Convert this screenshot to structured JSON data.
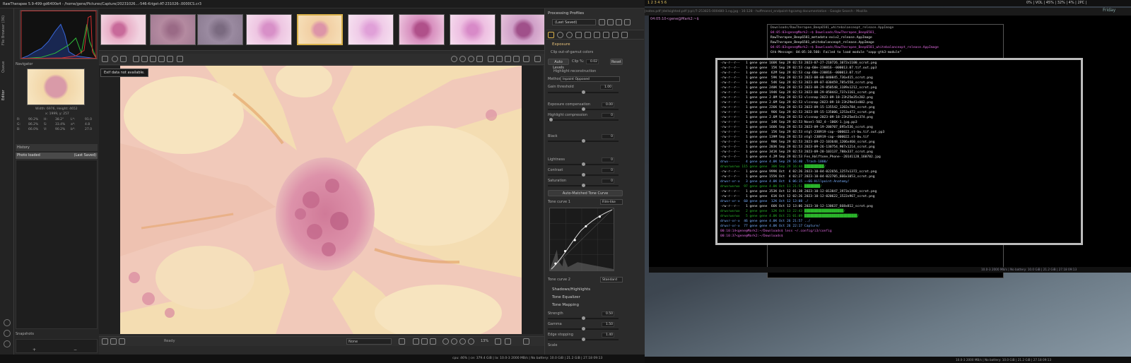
{
  "window_title": "RawTherapee 5.9-499-gd6400e4 - /home/gene/Pictures/Capture/20231026...-546-Kriget-AT-231026-.0000CS.cr3",
  "left_tabs": [
    "File Browser (36)",
    "Queue",
    "Editor"
  ],
  "navigator": {
    "label": "Navigator",
    "dims": "Width: 6976, Height: 4652",
    "coords": "x: 1999, y: 257",
    "rgb": [
      "R:",
      "90.2%",
      "G:",
      "86.2%",
      "B:",
      "66.0%"
    ],
    "hsv": [
      "H:",
      "38.2°",
      "S:",
      "33.4%",
      "V:",
      "90.2%"
    ],
    "lab": [
      "L*:",
      "91.0",
      "a*:",
      "4.8",
      "b*:",
      "27.0"
    ]
  },
  "history": {
    "label": "History",
    "row_left": "Photo loaded",
    "row_right": "(Last Saved)"
  },
  "snapshots": {
    "label": "Snapshots",
    "add": "+",
    "remove": "−"
  },
  "preview": {
    "exif_badge": "Exif data not available.",
    "status": "Ready",
    "zoom": "13%",
    "select": "None"
  },
  "right_panel": {
    "header": "Processing Profiles",
    "profile": "(Last Saved)",
    "section": "Exposure",
    "clip": "Clip out-of-gamut colors",
    "auto_levels": "Auto Levels",
    "clip_label": "Clip %:",
    "clip_val": "0.02",
    "reset": "Reset",
    "hr": "Highlight reconstruction",
    "method_label": "Method:",
    "method": "Inpaint Opposed",
    "gain_label": "Gain threshold",
    "gain_val": "1.00",
    "sliders": [
      {
        "label": "Exposure compensation",
        "val": "0.00"
      },
      {
        "label": "Highlight compression",
        "val": "0"
      },
      {
        "label": "Black",
        "val": "0"
      },
      {
        "label": "Lightness",
        "val": "0"
      },
      {
        "label": "Contrast",
        "val": "0"
      },
      {
        "label": "Saturation",
        "val": "0"
      }
    ],
    "auto_tc": "Auto-Matched Tone Curve",
    "tc1": "Tone curve 1",
    "tc1_mode": "Film-like",
    "tc2": "Tone curve 2",
    "tc2_mode": "Standard",
    "sections": [
      "Shadows/Highlights",
      "Tone Equalizer",
      "Tone Mapping"
    ],
    "tm_sliders": [
      {
        "label": "Strength",
        "val": "0.50"
      },
      {
        "label": "Gamma",
        "val": "1.50"
      },
      {
        "label": "Edge stopping",
        "val": "1.40"
      },
      {
        "label": "Scale",
        "val": ""
      }
    ]
  },
  "rt_status": "cpu: 46% | ce: 379.4 GiB | la: 10.0-3 2000 MB/s | No battery: 10.0 GiB | 21.2 GiB | 27.18 09:13",
  "desktop": {
    "ws": "1 2 3 4 5 6",
    "tabs": "|notes.pdf            |dellsighted.pdf           |cpl:/7-253825-000480-1.ng.jpg - 16:128 - huffmannl_endpoint-hgcamg documentation - Google Search - Mozilla",
    "right_status": "0% | VOL | 45% | 32% | 4% | 2PC |",
    "clock": "Friday"
  },
  "terminal_top": "04:05:10<gene@Mark2:~$",
  "terminal2": [
    "Downloads/RawTherapee_Beep6581_whitebalanceopt_release.AppImage",
    "04:05:03<gene@Mark2:~$ Downloads/RawTherapee_Beep6581_",
    "RawTherapee_Beep6581_metadata-exiv2_release.AppImage",
    "RawTherapee_Beep6581_whitebalanceopt_release.AppImage",
    "04:05:03<gene@Mark2:~$ Downloads/RawTherapee_Beep6581_whitebalanceopt_release.AppImage",
    "Gtk-Message: 04:05:10.560: Failed to load module \"xapp-gtk3-module\""
  ],
  "terminal_listing": [
    "-rw-r--r--   1 gene gene 166K Sep 29 02:53 2023-07-27-210726_1072x1100_scrot.png",
    "-rw-r--r--   1 gene gene  15K Sep 29 02:53 cap-60e-230816--000013.07.tif.out.pp3",
    "-rw-r--r--   1 gene gene  62M Sep 29 02:53 cap-60e-230816--000013.07.tif",
    "-rw-r--r--   1 gene gene  59K Sep 29 02:53 2023-08-08-040845_736x415_scrot.png",
    "-rw-r--r--   1 gene gene  54K Sep 29 02:53 2023-09-07-030459_785x558_scrot.png",
    "-rw-r--r--   1 gene gene 240K Sep 29 02:53 2023-08-29-050548_1189x1212_scrot.png",
    "-rw-r--r--   1 gene gene 194K Sep 29 02:53 2023-08-29-050443_737x1161_scrot.png",
    "-rw-r--r--   1 gene gene 2.8M Sep 29 02:53 vlcsnap-2023-09-18-23h25m35s202.png",
    "-rw-r--r--   1 gene gene 2.6M Sep 29 02:53 vlcsnap-2023-09-18-23h29m41s002.png",
    "-rw-r--r--   1 gene gene 226K Sep 29 02:53 2023-09-15-135542_1202x784_scrot.png",
    "-rw-r--r--   1 gene gene  96K Sep 29 02:53 2023-09-15-135006_1253x472_scrot.png",
    "-rw-r--r--   1 gene gene 2.6M Sep 29 02:53 vlcsnap-2023-09-18-23h25m41s374.png",
    "-rw-r--r--   1 gene gene  14K Sep 29 02:53 Novel-502_4--100X-1.jpg.pp3",
    "-rw-r--r--   1 gene gene 166K Sep 29 02:53 2023-09-19-200707_695x536_scrot.png",
    "-rw-r--r--   1 gene gene  15K Sep 29 02:53 ntgl-230919-cap--000022.st-bw.tif.out.pp3",
    "-rw-r--r--   1 gene gene 139M Sep 29 02:53 ntgl-230919-cap--000022.st-bw.tif",
    "-rw-r--r--   1 gene gene  90K Sep 29 02:53 2023-09-22-103648_1206x460_scrot.png",
    "-rw-r--r--   1 gene gene 203K Sep 29 02:53 2023-09-26-130754_907x1214_scrot.png",
    "-rw-r--r--   1 gene gene 341K Sep 29 02:53 2023-09-28-103137_788x337_scrot.png",
    "-rw-r--r--   1 gene gene 4.2M Sep 29 02:53 Fes_Halftone_Phone--20141128_160702.jpg",
    "drwx------   4 gene gene 4.0K Sep 29 16:40 .Trash-1000/",
    "drwxrwxrwx 115 gene gene  36K Sep 29 16:44 ██████████/",
    "-rw-r--r--   1 gene gene 999K Oct  4 02:26 2023-10-04-022656_1257x1372_scrot.png",
    "-rw-r--r--   1 gene gene 155K Oct  4 02:27 2023-10-04-022705_666x1053_scrot.png",
    "drwxr-xr-x   3 gene gene 4.0K Oct  6 06:15 ~~66-Hillpoint-Anatomy/",
    "drwxrwxrwx  97 gene gene 4.0K Oct 11 21:51 ████████/",
    "-rw-r--r--   1 gene gene 353K Oct 12 01:38 2023-10-12-013847_1973x1408_scrot.png",
    "-rw-r--r--   1 gene gene  61K Oct 12 02:26 2023-10-12-020622_1522x967_scrot.png",
    "drwxr-xr-x  60 gene gene  12K Oct 12 13:08 ./",
    "-rw-r--r--   1 gene gene  66K Oct 12 13:06 2023-10-12-130637_668x812_scrot.png",
    "drwxrwxrwx   2 gene gene  12K Oct 13 22:43 ████████████████████/",
    "drwxrwxrwx   5 gene gene 4.0K Oct 21 01:09 ███████████████████████████/",
    "drwxr-xr-x  46 gene gene 4.0K Oct 26 21:57 ../",
    "drwxr-xr-x  77 gene gene 4.0K Oct 26 22:17 Capture/",
    "00:10:14<gene@Mark2:~/Downloads$ less ~/.config/i3/config",
    "00:10:37<gene@Mark2:~/Downloads$ "
  ],
  "term_status": "10.0-3 2000 MB/s | No battery: 10.0 GiB | 21.2 GiB | 27.18 09:13",
  "bottom_status": "10.0-3 2000 MB/s | No battery: 10.0 GiB | 21.2 GiB | 27.18 09:13"
}
